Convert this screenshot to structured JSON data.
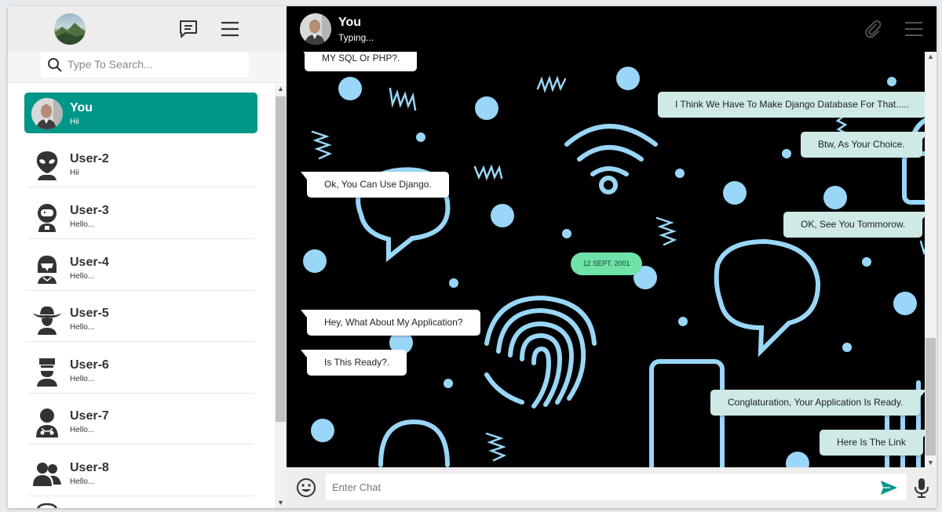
{
  "sidebar": {
    "search_placeholder": "Type To Search...",
    "contacts": [
      {
        "name": "You",
        "last": "Hii",
        "icon": "profile-photo"
      },
      {
        "name": "User-2",
        "last": "Hii",
        "icon": "alien-icon"
      },
      {
        "name": "User-3",
        "last": "Hello...",
        "icon": "astronaut-icon"
      },
      {
        "name": "User-4",
        "last": "Hello...",
        "icon": "helmet-icon"
      },
      {
        "name": "User-5",
        "last": "Hello...",
        "icon": "cowboy-icon"
      },
      {
        "name": "User-6",
        "last": "Hello...",
        "icon": "police-icon"
      },
      {
        "name": "User-7",
        "last": "Hello...",
        "icon": "doctor-icon"
      },
      {
        "name": "User-8",
        "last": "Hello...",
        "icon": "users-icon"
      }
    ]
  },
  "chat": {
    "contact_name": "You",
    "status": "Typing...",
    "input_placeholder": "Enter Chat",
    "date_label": "12 SEPT. 2001",
    "messages": [
      {
        "dir": "in",
        "text": "MY SQL Or PHP?."
      },
      {
        "dir": "out",
        "text": "I Think We Have To Make Django Database For That....."
      },
      {
        "dir": "out",
        "text": "Btw, As Your Choice."
      },
      {
        "dir": "in",
        "text": "Ok, You Can Use Django."
      },
      {
        "dir": "out",
        "text": "OK, See You Tommorow."
      },
      {
        "dir": "in",
        "text": "Hey, What About My Application?"
      },
      {
        "dir": "in",
        "text": "Is This Ready?."
      },
      {
        "dir": "out",
        "text": "Conglaturation, Your Application Is Ready."
      },
      {
        "dir": "out",
        "text": "Here Is The Link"
      }
    ]
  },
  "colors": {
    "accent": "#009688",
    "outgoing_bubble": "#cfe9e6",
    "pattern": "#99d6f7",
    "date_badge": "#6ee2a8"
  }
}
